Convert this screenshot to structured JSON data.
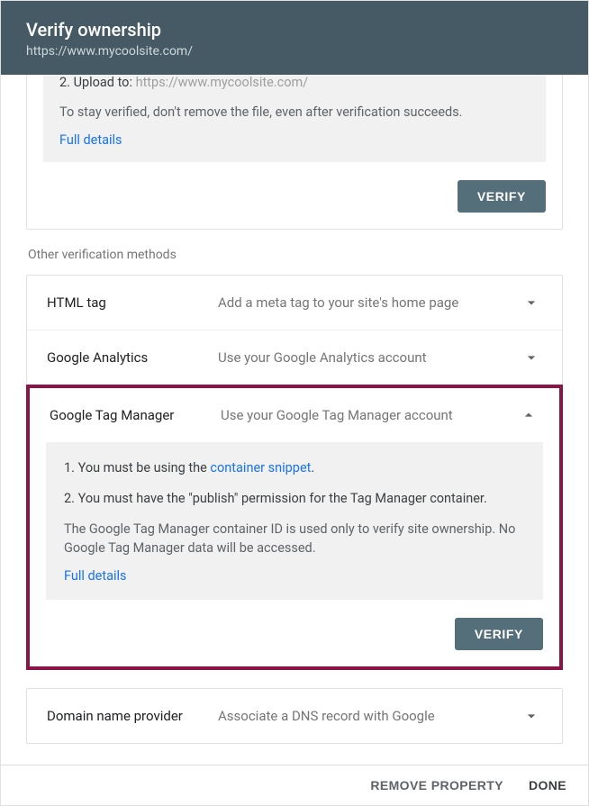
{
  "header": {
    "title": "Verify ownership",
    "url": "https://www.mycoolsite.com/"
  },
  "top_card": {
    "step_prefix": "2. Upload to:",
    "step_url": "https://www.mycoolsite.com/",
    "note": "To stay verified, don't remove the file, even after verification succeeds.",
    "details_link": "Full details",
    "verify": "VERIFY"
  },
  "section_label": "Other verification methods",
  "methods": {
    "html_tag": {
      "name": "HTML tag",
      "desc": "Add a meta tag to your site's home page"
    },
    "ga": {
      "name": "Google Analytics",
      "desc": "Use your Google Analytics account"
    },
    "gtm": {
      "name": "Google Tag Manager",
      "desc": "Use your Google Tag Manager account",
      "step1_pre": "You must be using the ",
      "step1_link": "container snippet",
      "step1_post": ".",
      "step2": "You must have the \"publish\" permission for the Tag Manager container.",
      "note": "The Google Tag Manager container ID is used only to verify site ownership. No Google Tag Manager data will be accessed.",
      "details_link": "Full details",
      "verify": "VERIFY"
    },
    "dns": {
      "name": "Domain name provider",
      "desc": "Associate a DNS record with Google"
    }
  },
  "footer": {
    "remove": "REMOVE PROPERTY",
    "done": "DONE"
  }
}
